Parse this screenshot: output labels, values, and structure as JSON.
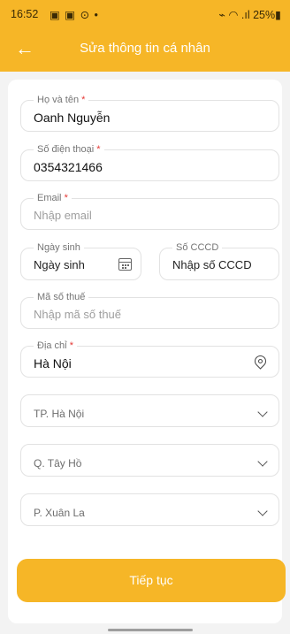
{
  "status_bar": {
    "time": "16:52",
    "left_icons": "▣ ▣ ⊙ •",
    "right_text": "⌁ ◠ .ıl 25%▮"
  },
  "app_bar": {
    "back_icon": "arrow-left-icon",
    "title": "Sửa thông tin cá nhân"
  },
  "form": {
    "name": {
      "label": "Họ và tên",
      "required": "*",
      "value": "Oanh Nguyễn"
    },
    "phone": {
      "label": "Số điện thoại",
      "required": "*",
      "value": "0354321466"
    },
    "email": {
      "label": "Email",
      "required": "*",
      "placeholder": "Nhập email"
    },
    "birthday": {
      "label": "Ngày sinh",
      "placeholder": "Ngày sinh",
      "icon": "calendar-icon"
    },
    "cccd": {
      "label": "Số CCCD",
      "placeholder": "Nhập số CCCD"
    },
    "tax": {
      "label": "Mã số thuế",
      "placeholder": "Nhập mã số thuế"
    },
    "address": {
      "label": "Địa chỉ",
      "required": "*",
      "value": "Hà Nội",
      "icon": "location-pin-icon"
    },
    "city": {
      "value": "TP. Hà Nội"
    },
    "district": {
      "value": "Q. Tây Hồ"
    },
    "ward": {
      "value": "P. Xuân La"
    }
  },
  "continue_label": "Tiếp tục",
  "colors": {
    "brand": "#f6b627",
    "required": "#e53935"
  }
}
